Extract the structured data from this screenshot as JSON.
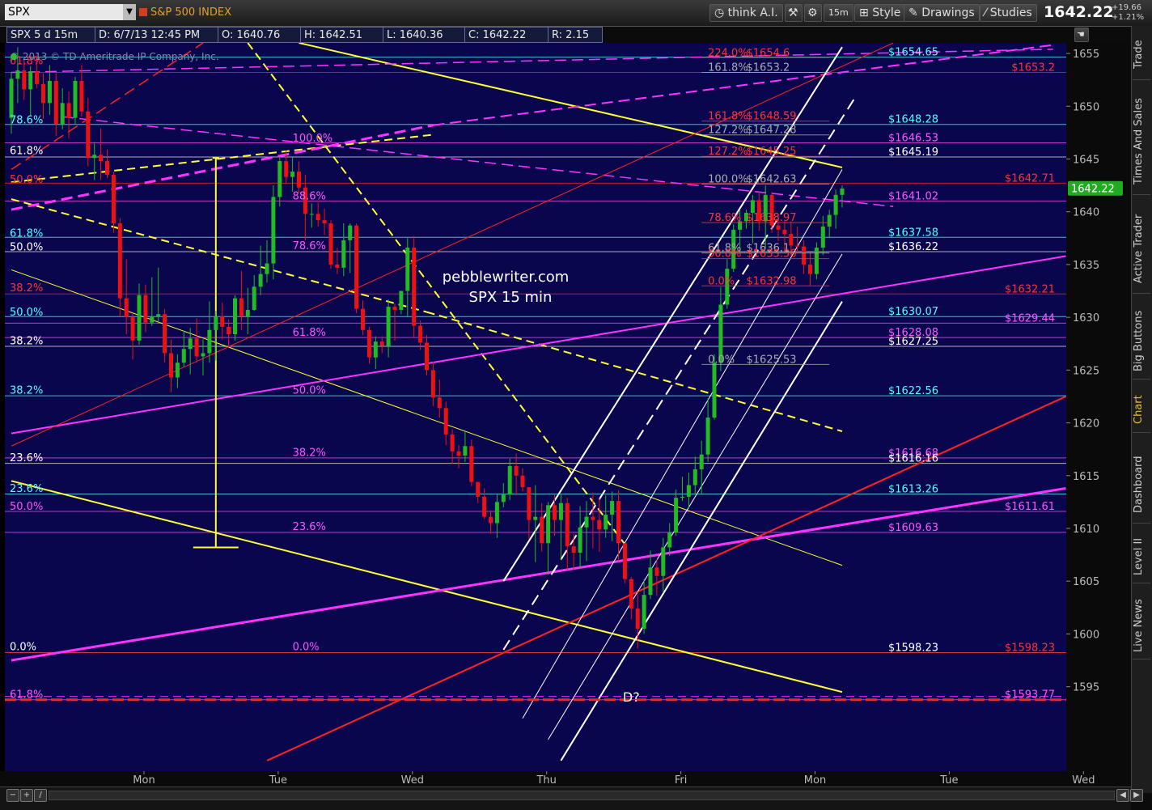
{
  "toolbar": {
    "symbol": "SPX",
    "symbol_name": "S&P 500 INDEX",
    "think_label": "think A.I.",
    "interval": "15m",
    "style_label": "Style",
    "drawings_label": "Drawings",
    "studies_label": "Studies",
    "last_price": "1642.22",
    "change_abs": "+19.66",
    "change_pct": "+1.21%"
  },
  "info": {
    "symbol_interval": "SPX 5 d 15m",
    "date": "D: 6/7/13 12:45 PM",
    "open": "O: 1640.76",
    "high": "H: 1642.51",
    "low": "L: 1640.36",
    "close": "C: 1642.22",
    "range": "R: 2.15"
  },
  "side_tabs": [
    "Trade",
    "Times And Sales",
    "Active Trader",
    "Big Buttons",
    "Chart",
    "Dashboard",
    "Level II",
    "Live News"
  ],
  "colors": {
    "background": "#09064e",
    "up_candle": "#22bb22",
    "down_candle": "#ee1111",
    "magenta": "#ff33ff",
    "yellow": "#ffff33",
    "red_line": "#ff2222",
    "cyan": "#55ffff",
    "white": "#ffffff",
    "price_marker": "#22aa22"
  },
  "chart_data": {
    "type": "candlestick",
    "copyright": "© 2013 © TD Ameritrade IP Company, Inc.",
    "watermark": [
      "pebblewriter.com",
      "SPX 15 min"
    ],
    "annotation": "D?",
    "price_marker": 1642.22,
    "ylim": [
      1587,
      1656
    ],
    "y_ticks": [
      1595,
      1600,
      1605,
      1610,
      1615,
      1620,
      1625,
      1630,
      1635,
      1640,
      1645,
      1650,
      1655
    ],
    "x_labels": [
      {
        "label": "Mon",
        "slot": 20
      },
      {
        "label": "Tue",
        "slot": 41
      },
      {
        "label": "Wed",
        "slot": 62
      },
      {
        "label": "Thu",
        "slot": 83
      },
      {
        "label": "Fri",
        "slot": 104
      },
      {
        "label": "Mon",
        "slot": 125
      },
      {
        "label": "Tue",
        "slot": 146
      },
      {
        "label": "Wed",
        "slot": 167
      }
    ],
    "price_labels": [
      {
        "text": "$1654.65",
        "price": 1654.65,
        "color": "#55ffff",
        "col": "mid"
      },
      {
        "text": "$1653.2",
        "price": 1653.2,
        "color": "#ff3333",
        "col": "right"
      },
      {
        "text": "$1648.28",
        "price": 1648.28,
        "color": "#55ffff",
        "col": "mid"
      },
      {
        "text": "$1646.53",
        "price": 1646.53,
        "color": "#ff55ff",
        "col": "mid"
      },
      {
        "text": "$1645.19",
        "price": 1645.19,
        "color": "#ffffff",
        "col": "mid"
      },
      {
        "text": "$1642.71",
        "price": 1642.71,
        "color": "#ff3333",
        "col": "right"
      },
      {
        "text": "$1641.02",
        "price": 1641.02,
        "color": "#ff55ff",
        "col": "mid"
      },
      {
        "text": "$1637.58",
        "price": 1637.58,
        "color": "#55ffff",
        "col": "mid"
      },
      {
        "text": "$1636.22",
        "price": 1636.22,
        "color": "#ffffff",
        "col": "mid"
      },
      {
        "text": "$1632.21",
        "price": 1632.21,
        "color": "#ff3333",
        "col": "right"
      },
      {
        "text": "$1630.07",
        "price": 1630.07,
        "color": "#55ffff",
        "col": "mid"
      },
      {
        "text": "$1629.44",
        "price": 1629.44,
        "color": "#ff55ff",
        "col": "right"
      },
      {
        "text": "$1628.08",
        "price": 1628.08,
        "color": "#ff55ff",
        "col": "mid"
      },
      {
        "text": "$1627.25",
        "price": 1627.25,
        "color": "#ffffff",
        "col": "mid"
      },
      {
        "text": "$1622.56",
        "price": 1622.56,
        "color": "#55ffff",
        "col": "mid"
      },
      {
        "text": "$1616.68",
        "price": 1616.68,
        "color": "#ff55ff",
        "col": "mid"
      },
      {
        "text": "$1616.16",
        "price": 1616.16,
        "color": "#ffffff",
        "col": "mid"
      },
      {
        "text": "$1613.26",
        "price": 1613.26,
        "color": "#55ffff",
        "col": "mid"
      },
      {
        "text": "$1611.61",
        "price": 1611.61,
        "color": "#ff55ff",
        "col": "right"
      },
      {
        "text": "$1609.63",
        "price": 1609.63,
        "color": "#ff55ff",
        "col": "mid"
      },
      {
        "text": "$1598.23",
        "price": 1598.23,
        "color": "#ffffff",
        "col": "mid"
      },
      {
        "text": "$1598.23",
        "price": 1598.23,
        "color": "#ff3333",
        "col": "right"
      },
      {
        "text": "$1593.77",
        "price": 1593.77,
        "color": "#ff55ff",
        "col": "right"
      }
    ],
    "left_fib_labels": [
      {
        "text": "61.8%",
        "price": 1653.8,
        "color": "#ff3333"
      },
      {
        "text": "78.6%",
        "price": 1648.2,
        "color": "#55ffff"
      },
      {
        "text": "61.8%",
        "price": 1645.3,
        "color": "#ffffff"
      },
      {
        "text": "50.0%",
        "price": 1642.6,
        "color": "#ff3333"
      },
      {
        "text": "61.8%",
        "price": 1637.5,
        "color": "#55ffff"
      },
      {
        "text": "50.0%",
        "price": 1636.2,
        "color": "#ffffff"
      },
      {
        "text": "38.2%",
        "price": 1632.3,
        "color": "#ff3333"
      },
      {
        "text": "50.0%",
        "price": 1630.0,
        "color": "#55ffff"
      },
      {
        "text": "38.2%",
        "price": 1627.3,
        "color": "#ffffff"
      },
      {
        "text": "38.2%",
        "price": 1622.6,
        "color": "#55ffff"
      },
      {
        "text": "23.6%",
        "price": 1616.2,
        "color": "#ffffff"
      },
      {
        "text": "23.6%",
        "price": 1613.3,
        "color": "#55ffff"
      },
      {
        "text": "50.0%",
        "price": 1611.6,
        "color": "#ff55ff"
      },
      {
        "text": "0.0%",
        "price": 1598.3,
        "color": "#ffffff"
      },
      {
        "text": "61.8%",
        "price": 1593.8,
        "color": "#ff55ff"
      }
    ],
    "mid_fib_labels": [
      {
        "text": "100.0%",
        "price": 1646.5
      },
      {
        "text": "88.6%",
        "price": 1641.0
      },
      {
        "text": "78.6%",
        "price": 1636.3
      },
      {
        "text": "61.8%",
        "price": 1628.1
      },
      {
        "text": "50.0%",
        "price": 1622.6
      },
      {
        "text": "38.2%",
        "price": 1616.7
      },
      {
        "text": "23.6%",
        "price": 1609.7
      },
      {
        "text": "0.0%",
        "price": 1598.3
      }
    ],
    "right_fib_labels": [
      {
        "text": "224.0%",
        "price": 1654.6,
        "value": "$1654.6",
        "color": "#ff3333"
      },
      {
        "text": "161.8%",
        "price": 1653.2,
        "value": "$1653.2",
        "color": "#aaaaaa"
      },
      {
        "text": "161.8%",
        "price": 1648.59,
        "value": "$1648.59",
        "color": "#ff3333"
      },
      {
        "text": "127.2%",
        "price": 1647.28,
        "value": "$1647.28",
        "color": "#aaaaaa"
      },
      {
        "text": "127.2%",
        "price": 1645.25,
        "value": "$1645.25",
        "color": "#ff3333"
      },
      {
        "text": "100.0%",
        "price": 1642.63,
        "value": "$1642.63",
        "color": "#aaaaaa"
      },
      {
        "text": "78.6%",
        "price": 1638.97,
        "value": "$1638.97",
        "color": "#ff3333"
      },
      {
        "text": "61.8%",
        "price": 1636.1,
        "value": "$1636.1",
        "color": "#aaaaaa"
      },
      {
        "text": "50.0%",
        "price": 1635.56,
        "value": "$1635.56",
        "color": "#ff3333"
      },
      {
        "text": "0.0%",
        "price": 1632.98,
        "value": "$1632.98",
        "color": "#ff3333"
      },
      {
        "text": "0.0%",
        "price": 1625.53,
        "value": "$1625.53",
        "color": "#aaaaaa"
      }
    ],
    "candles": [
      [
        1648.9,
        1653.2,
        1647.4,
        1652.6
      ],
      [
        1652.6,
        1655.6,
        1650.3,
        1653.4
      ],
      [
        1653.4,
        1654.4,
        1650.6,
        1651.6
      ],
      [
        1651.6,
        1653.8,
        1649.1,
        1653.3
      ],
      [
        1653.3,
        1654.8,
        1651.7,
        1652.1
      ],
      [
        1652.1,
        1653.1,
        1648.8,
        1650.3
      ],
      [
        1650.3,
        1653.9,
        1649.2,
        1652.4
      ],
      [
        1652.4,
        1653.1,
        1647.2,
        1648.3
      ],
      [
        1648.3,
        1651.7,
        1647.8,
        1650.3
      ],
      [
        1650.3,
        1651.4,
        1647.0,
        1648.9
      ],
      [
        1648.9,
        1652.8,
        1648.3,
        1652.4
      ],
      [
        1652.4,
        1653.9,
        1649.0,
        1649.5
      ],
      [
        1649.5,
        1650.8,
        1644.3,
        1645.1
      ],
      [
        1645.1,
        1646.6,
        1643.0,
        1645.4
      ],
      [
        1645.4,
        1647.9,
        1643.0,
        1644.8
      ],
      [
        1644.8,
        1645.9,
        1643.2,
        1643.5
      ],
      [
        1643.5,
        1643.8,
        1638.0,
        1638.9
      ],
      [
        1638.9,
        1639.4,
        1630.1,
        1631.8
      ],
      [
        1631.8,
        1635.5,
        1628.4,
        1630.0
      ],
      [
        1630.0,
        1630.4,
        1626.0,
        1627.8
      ],
      [
        1627.8,
        1633.2,
        1627.4,
        1632.1
      ],
      [
        1632.1,
        1633.1,
        1628.6,
        1629.5
      ],
      [
        1629.5,
        1633.8,
        1629.2,
        1630.1
      ],
      [
        1630.1,
        1634.7,
        1629.4,
        1630.3
      ],
      [
        1630.3,
        1630.8,
        1625.7,
        1626.6
      ],
      [
        1626.6,
        1627.9,
        1622.9,
        1624.3
      ],
      [
        1624.3,
        1626.5,
        1623.3,
        1625.7
      ],
      [
        1625.7,
        1628.7,
        1625.3,
        1627.0
      ],
      [
        1627.0,
        1629.0,
        1624.6,
        1628.0
      ],
      [
        1628.0,
        1629.9,
        1625.7,
        1626.3
      ],
      [
        1626.3,
        1627.9,
        1624.5,
        1626.6
      ],
      [
        1626.6,
        1631.5,
        1625.7,
        1628.8
      ],
      [
        1628.8,
        1630.6,
        1625.9,
        1630.1
      ],
      [
        1630.1,
        1631.4,
        1627.9,
        1629.1
      ],
      [
        1629.1,
        1629.8,
        1627.2,
        1628.4
      ],
      [
        1628.4,
        1632.1,
        1627.8,
        1631.8
      ],
      [
        1631.8,
        1634.4,
        1628.8,
        1630.1
      ],
      [
        1630.1,
        1632.8,
        1628.4,
        1630.7
      ],
      [
        1630.7,
        1634.0,
        1630.6,
        1632.9
      ],
      [
        1632.9,
        1636.8,
        1632.1,
        1634.1
      ],
      [
        1634.1,
        1637.3,
        1633.3,
        1635.1
      ],
      [
        1635.1,
        1642.5,
        1633.6,
        1641.4
      ],
      [
        1641.4,
        1645.2,
        1640.5,
        1644.8
      ],
      [
        1644.8,
        1645.8,
        1642.7,
        1643.3
      ],
      [
        1643.3,
        1645.2,
        1641.9,
        1643.8
      ],
      [
        1643.8,
        1644.8,
        1641.8,
        1642.3
      ],
      [
        1642.3,
        1643.5,
        1637.3,
        1639.8
      ],
      [
        1639.8,
        1640.8,
        1638.5,
        1639.8
      ],
      [
        1639.8,
        1640.9,
        1638.6,
        1639.2
      ],
      [
        1639.2,
        1640.3,
        1637.8,
        1638.9
      ],
      [
        1638.9,
        1639.2,
        1634.6,
        1635.0
      ],
      [
        1635.0,
        1636.6,
        1634.1,
        1634.7
      ],
      [
        1634.7,
        1638.9,
        1633.9,
        1637.3
      ],
      [
        1637.3,
        1638.9,
        1634.2,
        1638.7
      ],
      [
        1638.7,
        1638.9,
        1630.4,
        1630.8
      ],
      [
        1630.8,
        1631.6,
        1628.3,
        1628.8
      ],
      [
        1628.8,
        1629.1,
        1625.6,
        1626.2
      ],
      [
        1626.2,
        1628.2,
        1625.1,
        1627.7
      ],
      [
        1627.7,
        1628.2,
        1626.6,
        1627.3
      ],
      [
        1627.3,
        1631.7,
        1626.2,
        1631.0
      ],
      [
        1631.0,
        1631.3,
        1627.8,
        1630.7
      ],
      [
        1630.7,
        1632.5,
        1630.3,
        1632.5
      ],
      [
        1632.5,
        1637.5,
        1630.0,
        1636.6
      ],
      [
        1636.6,
        1637.7,
        1628.1,
        1629.2
      ],
      [
        1629.2,
        1629.7,
        1626.9,
        1627.6
      ],
      [
        1627.6,
        1628.3,
        1624.5,
        1625.0
      ],
      [
        1625.0,
        1625.8,
        1621.6,
        1622.4
      ],
      [
        1622.4,
        1624.1,
        1620.5,
        1621.4
      ],
      [
        1621.4,
        1622.0,
        1617.9,
        1618.9
      ],
      [
        1618.9,
        1619.4,
        1616.1,
        1617.3
      ],
      [
        1617.3,
        1617.9,
        1615.7,
        1616.9
      ],
      [
        1616.9,
        1619.2,
        1616.3,
        1617.8
      ],
      [
        1617.8,
        1618.4,
        1614.0,
        1614.4
      ],
      [
        1614.4,
        1614.4,
        1612.4,
        1613.0
      ],
      [
        1613.0,
        1613.8,
        1610.9,
        1611.1
      ],
      [
        1611.1,
        1611.7,
        1609.5,
        1610.5
      ],
      [
        1610.5,
        1613.2,
        1609.1,
        1612.5
      ],
      [
        1612.5,
        1614.3,
        1612.0,
        1613.2
      ],
      [
        1613.2,
        1616.6,
        1612.7,
        1615.9
      ],
      [
        1615.9,
        1617.1,
        1613.1,
        1615.0
      ],
      [
        1615.0,
        1615.7,
        1613.5,
        1613.9
      ],
      [
        1613.9,
        1613.9,
        1609.0,
        1610.8
      ],
      [
        1610.8,
        1614.1,
        1606.8,
        1611.1
      ],
      [
        1611.1,
        1612.4,
        1607.8,
        1608.6
      ],
      [
        1608.6,
        1612.5,
        1605.6,
        1612.2
      ],
      [
        1612.2,
        1613.2,
        1609.3,
        1610.8
      ],
      [
        1610.8,
        1613.2,
        1607.0,
        1612.4
      ],
      [
        1612.4,
        1612.9,
        1606.1,
        1608.3
      ],
      [
        1608.3,
        1609.5,
        1606.1,
        1607.7
      ],
      [
        1607.7,
        1612.1,
        1606.2,
        1610.1
      ],
      [
        1610.1,
        1612.6,
        1606.9,
        1611.1
      ],
      [
        1611.1,
        1613.4,
        1608.1,
        1610.8
      ],
      [
        1610.8,
        1612.9,
        1607.8,
        1609.9
      ],
      [
        1609.9,
        1613.1,
        1609.1,
        1611.3
      ],
      [
        1611.3,
        1613.5,
        1608.8,
        1612.6
      ],
      [
        1612.6,
        1613.6,
        1606.9,
        1608.6
      ],
      [
        1608.6,
        1608.6,
        1604.8,
        1605.2
      ],
      [
        1605.2,
        1605.4,
        1601.4,
        1602.4
      ],
      [
        1602.4,
        1604.0,
        1598.6,
        1600.5
      ],
      [
        1600.5,
        1605.2,
        1600.0,
        1603.7
      ],
      [
        1603.7,
        1607.9,
        1603.3,
        1606.3
      ],
      [
        1606.3,
        1607.1,
        1603.6,
        1605.5
      ],
      [
        1605.5,
        1609.1,
        1603.9,
        1608.2
      ],
      [
        1608.2,
        1610.5,
        1607.4,
        1609.6
      ],
      [
        1609.6,
        1613.7,
        1609.3,
        1612.9
      ],
      [
        1612.9,
        1614.9,
        1612.6,
        1613.0
      ],
      [
        1613.0,
        1615.3,
        1611.9,
        1614.1
      ],
      [
        1614.1,
        1616.8,
        1613.2,
        1615.6
      ],
      [
        1615.6,
        1618.3,
        1613.2,
        1617.0
      ],
      [
        1617.0,
        1622.3,
        1616.3,
        1620.5
      ],
      [
        1620.5,
        1626.5,
        1620.3,
        1625.7
      ],
      [
        1625.7,
        1632.9,
        1624.9,
        1631.2
      ],
      [
        1631.2,
        1635.5,
        1630.8,
        1634.6
      ],
      [
        1634.6,
        1638.8,
        1634.3,
        1638.3
      ],
      [
        1638.3,
        1640.2,
        1636.1,
        1639.1
      ],
      [
        1639.1,
        1640.2,
        1638.4,
        1639.9
      ],
      [
        1639.9,
        1641.6,
        1637.0,
        1641.1
      ],
      [
        1641.1,
        1641.9,
        1638.2,
        1639.1
      ],
      [
        1639.1,
        1642.5,
        1636.6,
        1641.6
      ],
      [
        1641.6,
        1641.9,
        1638.0,
        1638.7
      ],
      [
        1638.7,
        1639.7,
        1637.2,
        1638.3
      ],
      [
        1638.3,
        1639.1,
        1636.4,
        1637.9
      ],
      [
        1637.9,
        1639.1,
        1636.0,
        1636.8
      ],
      [
        1636.8,
        1638.6,
        1636.1,
        1636.7
      ],
      [
        1636.7,
        1637.3,
        1634.1,
        1635.0
      ],
      [
        1635.0,
        1636.2,
        1633.0,
        1634.1
      ],
      [
        1634.1,
        1637.1,
        1633.6,
        1636.6
      ],
      [
        1636.6,
        1639.6,
        1635.9,
        1638.6
      ],
      [
        1638.6,
        1640.2,
        1637.5,
        1639.7
      ],
      [
        1639.7,
        1642.1,
        1638.4,
        1641.6
      ],
      [
        1641.6,
        1642.5,
        1640.4,
        1642.2
      ]
    ]
  }
}
